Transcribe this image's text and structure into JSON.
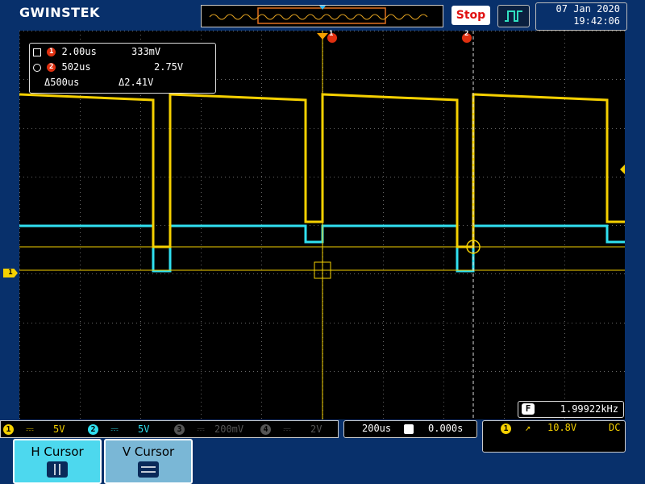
{
  "brand": "GWINSTEK",
  "header": {
    "stop_label": "Stop",
    "date": "07 Jan 2020",
    "time": "19:42:06",
    "trigger_mode_icon": "pulse-wave-icon"
  },
  "cursor_readout": {
    "row1": {
      "time": "2.00us",
      "value": "333mV"
    },
    "row2": {
      "time": "502us",
      "value": "2.75V"
    },
    "row3": {
      "time": "Δ500us",
      "value": "Δ2.41V"
    }
  },
  "markers": {
    "cursor1": "1",
    "cursor2": "2",
    "ch1_level": "1"
  },
  "frequency": {
    "icon_label": "F",
    "value": "1.99922kHz"
  },
  "channels": [
    {
      "num": "1",
      "scale": "5V",
      "color": "#f5d000"
    },
    {
      "num": "2",
      "scale": "5V",
      "color": "#30e0f0"
    },
    {
      "num": "3",
      "scale": "200mV",
      "color": "#555555"
    },
    {
      "num": "4",
      "scale": "2V",
      "color": "#555555"
    }
  ],
  "timebase": {
    "scale": "200us",
    "position": "0.000s"
  },
  "trigger": {
    "source": "1",
    "level": "10.8V",
    "coupling": "DC"
  },
  "softkeys": {
    "h_cursor": "H Cursor",
    "v_cursor": "V Cursor"
  },
  "colors": {
    "background": "#08306b",
    "ch1": "#f5d000",
    "ch2": "#30e0f0",
    "cursor_marker": "#e03010"
  }
}
